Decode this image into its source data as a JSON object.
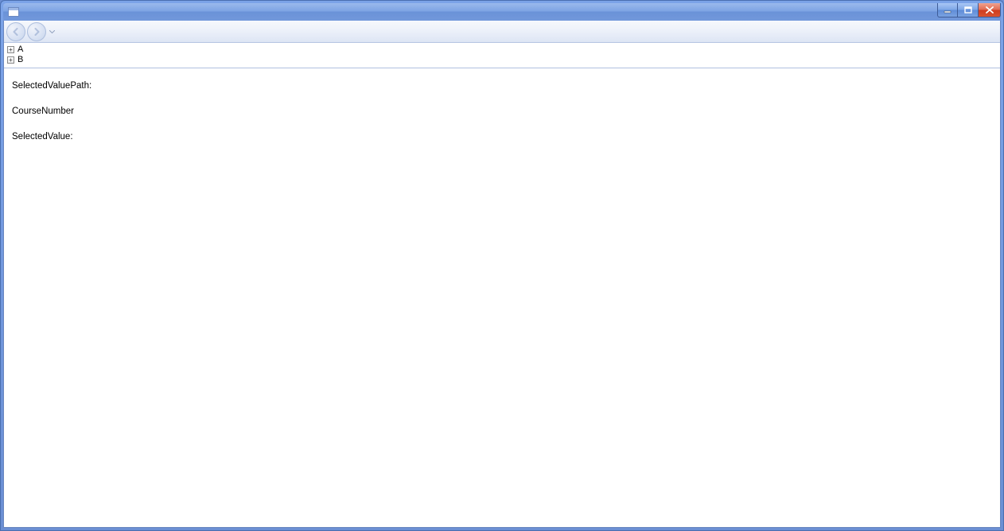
{
  "tree": {
    "items": [
      {
        "label": "A",
        "expanded": false
      },
      {
        "label": "B",
        "expanded": false
      }
    ]
  },
  "content": {
    "selectedValuePathLabel": "SelectedValuePath:",
    "selectedValuePathValue": "CourseNumber",
    "selectedValueLabel": "SelectedValue:"
  }
}
